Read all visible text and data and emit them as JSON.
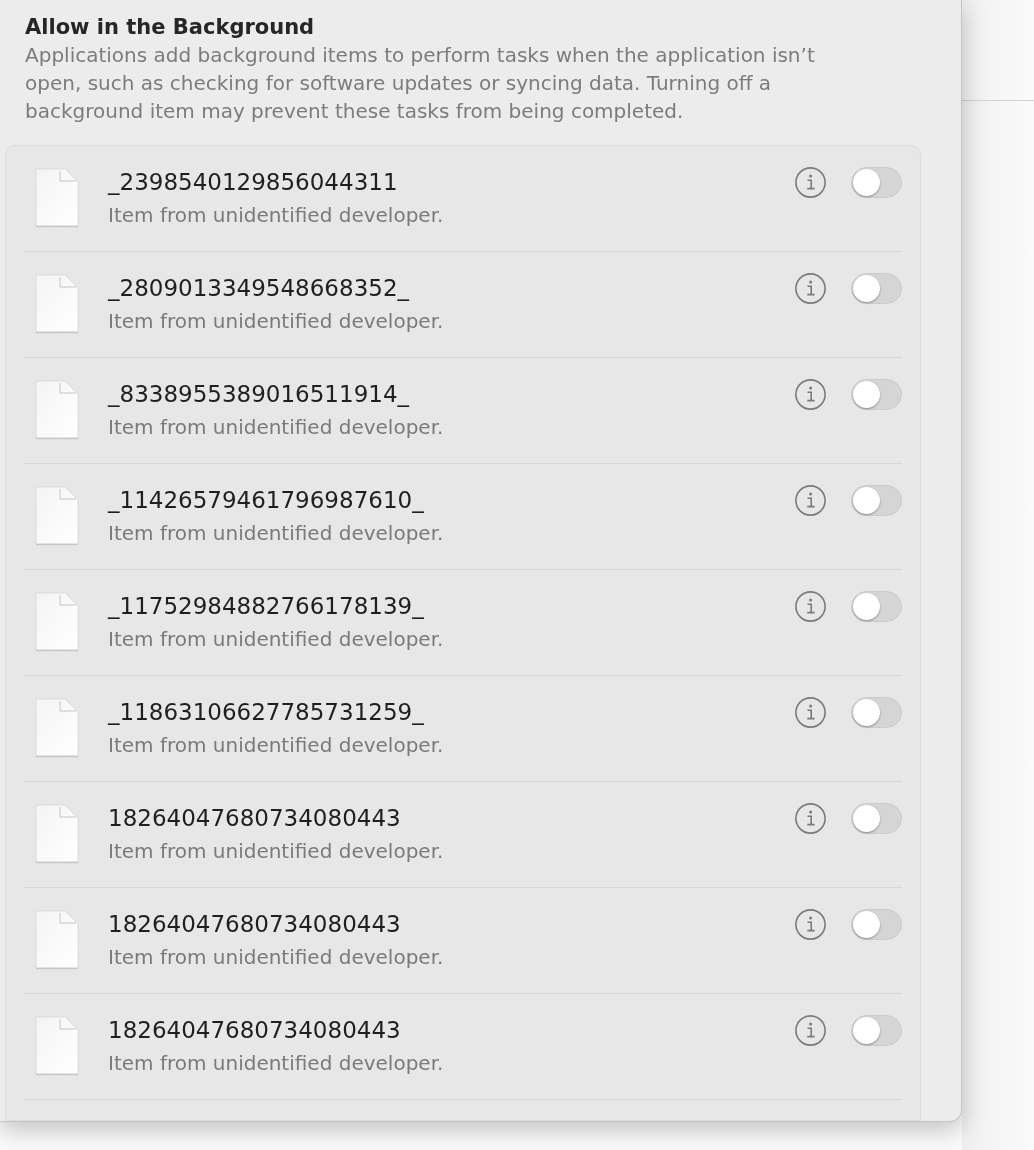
{
  "section": {
    "title": "Allow in the Background",
    "description": "Applications add background items to perform tasks when the application isn’t open, such as checking for software updates or syncing data. Turning off a background item may prevent these tasks from being completed."
  },
  "items": [
    {
      "name": "_2398540129856044311",
      "subtitle": "Item from unidentified developer.",
      "on": false
    },
    {
      "name": "_2809013349548668352_",
      "subtitle": "Item from unidentified developer.",
      "on": false
    },
    {
      "name": "_8338955389016511914_",
      "subtitle": "Item from unidentified developer.",
      "on": false
    },
    {
      "name": "_11426579461796987610_",
      "subtitle": "Item from unidentified developer.",
      "on": false
    },
    {
      "name": "_11752984882766178139_",
      "subtitle": "Item from unidentified developer.",
      "on": false
    },
    {
      "name": "_11863106627785731259_",
      "subtitle": "Item from unidentified developer.",
      "on": false
    },
    {
      "name": "18264047680734080443",
      "subtitle": "Item from unidentified developer.",
      "on": false
    },
    {
      "name": "18264047680734080443",
      "subtitle": "Item from unidentified developer.",
      "on": false
    },
    {
      "name": "18264047680734080443",
      "subtitle": "Item from unidentified developer.",
      "on": false
    }
  ]
}
